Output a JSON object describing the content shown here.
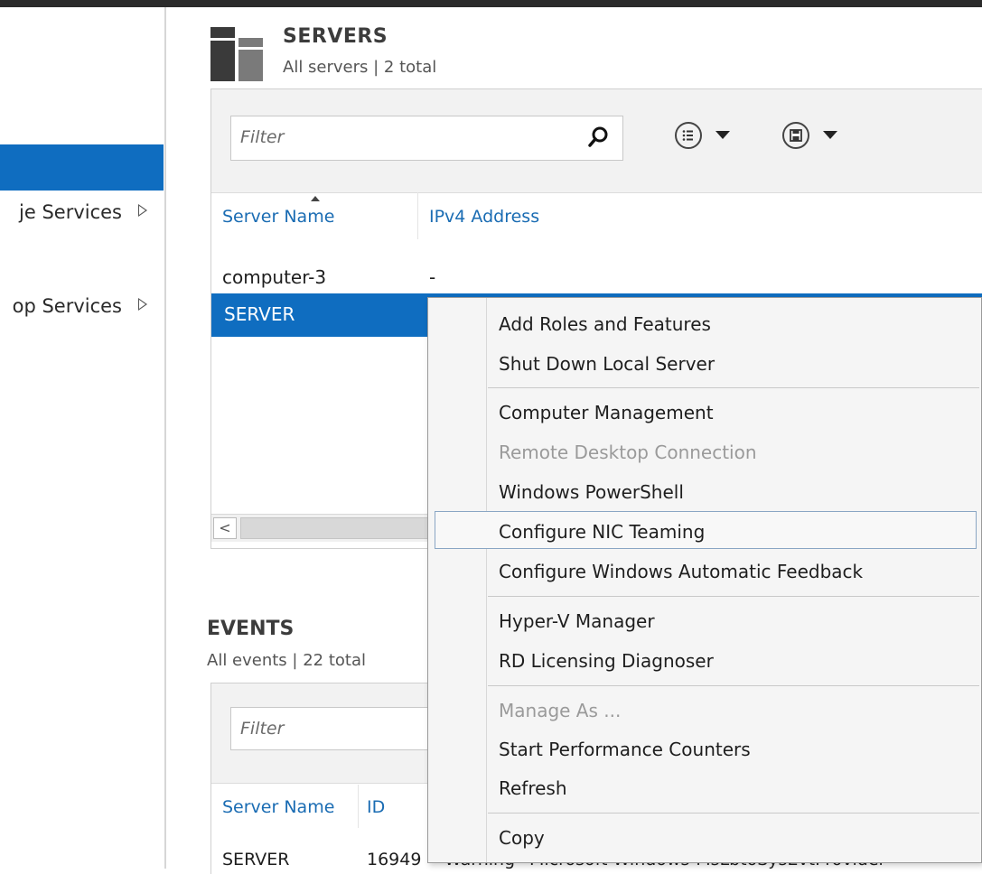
{
  "sidebar": {
    "items": [
      {
        "label": "je Services"
      },
      {
        "label": "op Services"
      }
    ]
  },
  "servers": {
    "title": "SERVERS",
    "subtitle": "All servers | 2 total",
    "filter_placeholder": "Filter",
    "columns": [
      "Server Name",
      "IPv4 Address"
    ],
    "rows": [
      {
        "name": "computer-3",
        "ipv4": "-"
      },
      {
        "name": "SERVER",
        "ipv4": ""
      }
    ],
    "scroll_left_glyph": "<"
  },
  "events": {
    "title": "EVENTS",
    "subtitle": "All events | 22 total",
    "filter_placeholder": "Filter",
    "columns": [
      "Server Name",
      "ID"
    ],
    "row": {
      "server": "SERVER",
      "id": "16949",
      "severity": "Warning",
      "source": "Microsoft-Windows-MsLbtoSysEvtProvider"
    }
  },
  "context_menu": {
    "items": [
      {
        "label": "Add Roles and Features",
        "enabled": true
      },
      {
        "label": "Shut Down Local Server",
        "enabled": true
      },
      {
        "label": "Computer Management",
        "enabled": true
      },
      {
        "label": "Remote Desktop Connection",
        "enabled": false
      },
      {
        "label": "Windows PowerShell",
        "enabled": true
      },
      {
        "label": "Configure NIC Teaming",
        "enabled": true,
        "highlighted": true
      },
      {
        "label": "Configure Windows Automatic Feedback",
        "enabled": true
      },
      {
        "label": "Hyper-V Manager",
        "enabled": true
      },
      {
        "label": "RD Licensing Diagnoser",
        "enabled": true
      },
      {
        "label": "Manage As ...",
        "enabled": false
      },
      {
        "label": "Start Performance Counters",
        "enabled": true
      },
      {
        "label": "Refresh",
        "enabled": true
      },
      {
        "label": "Copy",
        "enabled": true
      }
    ]
  },
  "colors": {
    "selection": "#0f6dc0",
    "link": "#1a6cb3",
    "disabled": "#9a9a9a"
  }
}
